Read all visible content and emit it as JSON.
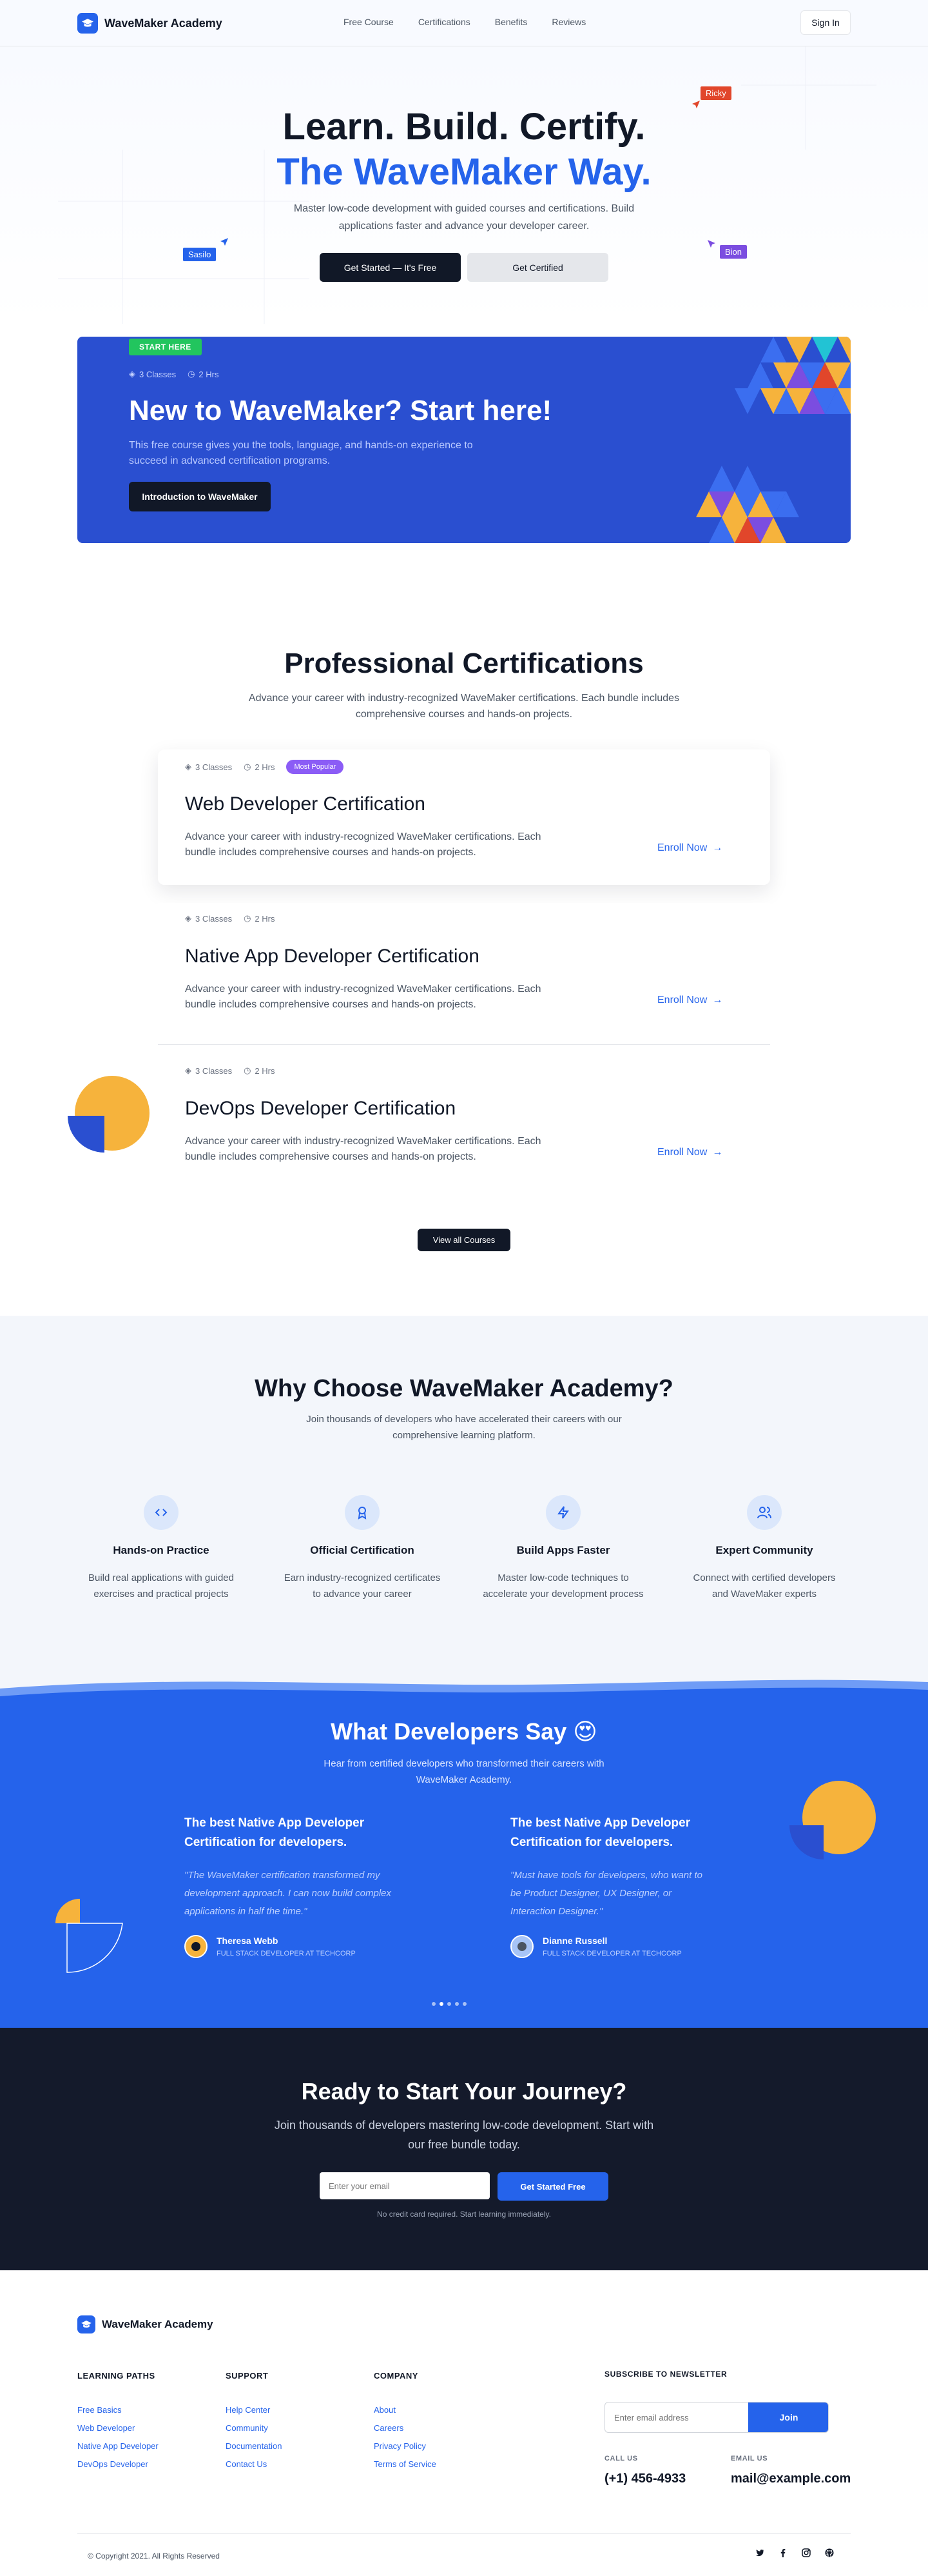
{
  "nav": {
    "brand": "WaveMaker Academy",
    "links": [
      "Free Course",
      "Certifications",
      "Benefits",
      "Reviews"
    ],
    "signin": "Sign In"
  },
  "hero": {
    "title_line1": "Learn. Build. Certify.",
    "title_line2": "The WaveMaker Way.",
    "subtitle_line1": "Master low-code development with guided courses and certifications. Build",
    "subtitle_line2": "applications faster and advance your developer career.",
    "primary_cta": "Get Started — It's Free",
    "secondary_cta": "Get Certified",
    "cursor_tags": {
      "ricky": "Ricky",
      "sasilo": "Sasilo",
      "bion": "Bion"
    },
    "colors": {
      "accent": "#2563eb",
      "dark": "#111827"
    }
  },
  "banner": {
    "badge": "START HERE",
    "classes": "3 Classes",
    "hours": "2 Hrs",
    "title": "New to WaveMaker? Start here!",
    "desc_line1": "This free course gives you the tools, language, and hands-on experience to",
    "desc_line2": "succeed in advanced certification programs.",
    "cta": "Introduction to WaveMaker"
  },
  "certifications": {
    "title": "Professional Certifications",
    "subtitle_line1": "Advance your career with industry-recognized WaveMaker certifications. Each bundle includes",
    "subtitle_line2": "comprehensive courses and hands-on projects.",
    "items": [
      {
        "classes": "3 Classes",
        "hours": "2 Hrs",
        "badge": "Most Popular",
        "title": "Web Developer Certification",
        "desc_line1": "Advance your career with industry-recognized WaveMaker certifications. Each",
        "desc_line2": "bundle includes comprehensive courses and hands-on projects.",
        "cta": "Enroll Now"
      },
      {
        "classes": "3 Classes",
        "hours": "2 Hrs",
        "title": "Native App Developer Certification",
        "desc_line1": "Advance your career with industry-recognized WaveMaker certifications. Each",
        "desc_line2": "bundle includes comprehensive courses and hands-on projects.",
        "cta": "Enroll Now"
      },
      {
        "classes": "3 Classes",
        "hours": "2 Hrs",
        "title": "DevOps Developer Certification",
        "desc_line1": "Advance your career with industry-recognized WaveMaker certifications. Each",
        "desc_line2": "bundle includes comprehensive courses and hands-on projects.",
        "cta": "Enroll Now"
      }
    ],
    "view_all": "View all Courses"
  },
  "why": {
    "title": "Why Choose WaveMaker Academy?",
    "subtitle_line1": "Join thousands of developers who have accelerated their careers with our",
    "subtitle_line2": "comprehensive learning platform.",
    "features": [
      {
        "icon": "code-icon",
        "title": "Hands-on Practice",
        "desc_line1": "Build real applications with guided",
        "desc_line2": "exercises and practical projects"
      },
      {
        "icon": "award-icon",
        "title": "Official Certification",
        "desc_line1": "Earn industry-recognized certificates",
        "desc_line2": "to advance your career"
      },
      {
        "icon": "lightning-icon",
        "title": "Build Apps Faster",
        "desc_line1": "Master low-code techniques to",
        "desc_line2": "accelerate your development process"
      },
      {
        "icon": "users-icon",
        "title": "Expert Community",
        "desc_line1": "Connect with certified developers",
        "desc_line2": "and WaveMaker experts"
      }
    ]
  },
  "testimonials": {
    "title": "What Developers Say 😍",
    "subtitle_line1": "Hear from certified developers who transformed their careers with",
    "subtitle_line2": "WaveMaker Academy.",
    "items": [
      {
        "heading_line1": "The best Native App Developer",
        "heading_line2": "Certification for developers.",
        "quote_line1": "\"The WaveMaker certification transformed my",
        "quote_line2": "development approach. I can now build complex",
        "quote_line3": "applications in half the time.\"",
        "name": "Theresa Webb",
        "role": "FULL STACK DEVELOPER AT TECHCORP"
      },
      {
        "heading_line1": "The best Native App Developer",
        "heading_line2": "Certification for developers.",
        "quote_line1": "\"Must have tools for developers, who want to",
        "quote_line2": "be Product Designer, UX Designer, or",
        "quote_line3": "Interaction Designer.\"",
        "name": "Dianne Russell",
        "role": "FULL STACK DEVELOPER AT TECHCORP"
      }
    ]
  },
  "cta_section": {
    "title": "Ready to Start Your Journey?",
    "subtitle_line1": "Join thousands of developers mastering low-code development. Start with",
    "subtitle_line2": "our free bundle today.",
    "email_placeholder": "Enter your email",
    "button": "Get Started Free",
    "note": "No credit card required. Start learning immediately."
  },
  "footer": {
    "brand": "WaveMaker Academy",
    "columns": [
      {
        "title": "LEARNING PATHS",
        "links": [
          "Free Basics",
          "Web Developer",
          "Native App Developer",
          "DevOps Developer"
        ]
      },
      {
        "title": "SUPPORT",
        "links": [
          "Help Center",
          "Community",
          "Documentation",
          "Contact Us"
        ]
      },
      {
        "title": "COMPANY",
        "links": [
          "About",
          "Careers",
          "Privacy Policy",
          "Terms of Service"
        ]
      }
    ],
    "newsletter_title": "SUBSCRIBE TO NEWSLETTER",
    "newsletter_placeholder": "Enter email address",
    "newsletter_button": "Join",
    "call_label": "CALL US",
    "phone": "(+1) 456-4933",
    "email_label": "EMAIL US",
    "email": "mail@example.com",
    "copyright": "© Copyright 2021. All Rights Reserved"
  }
}
